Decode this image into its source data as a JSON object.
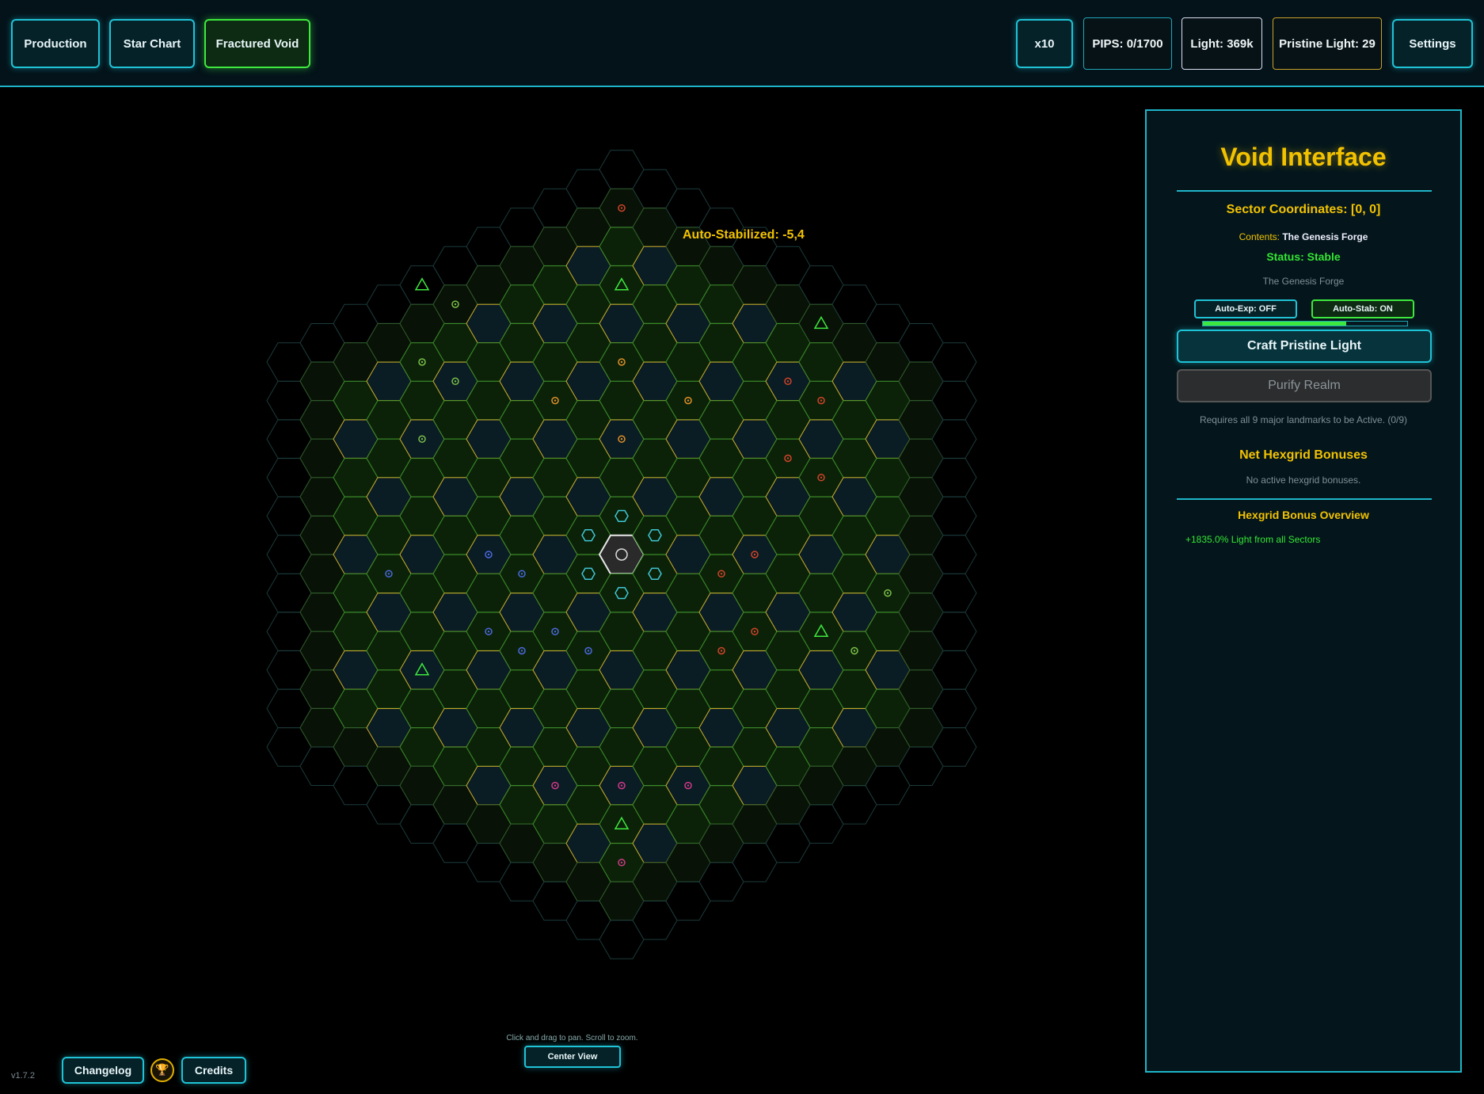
{
  "nav": {
    "production": "Production",
    "star_chart": "Star Chart",
    "fractured_void": "Fractured Void"
  },
  "stats": {
    "multiplier": "x10",
    "pips": "PIPS: 0/1700",
    "light": "Light: 369k",
    "pristine_light": "Pristine Light: 29",
    "settings": "Settings"
  },
  "map": {
    "tooltip": "Auto-Stabilized: -5,4",
    "hint": "Click and drag to pan. Scroll to zoom.",
    "center_view": "Center View"
  },
  "panel": {
    "title": "Void Interface",
    "sector": "Sector Coordinates: [0, 0]",
    "contents_label": "Contents:",
    "contents_value": "The Genesis Forge",
    "status": "Status: Stable",
    "description": "The Genesis Forge",
    "auto_exp": "Auto-Exp: OFF",
    "auto_stab": "Auto-Stab: ON",
    "stab_progress": 0.7,
    "craft": "Craft Pristine Light",
    "purify": "Purify Realm",
    "requires": "Requires all 9 major landmarks to be Active. (0/9)",
    "net_title": "Net Hexgrid Bonuses",
    "net_none": "No active hexgrid bonuses.",
    "overview_title": "Hexgrid Bonus Overview",
    "overview_item": "+1835.0% Light from all Sectors"
  },
  "footer": {
    "version": "v1.7.2",
    "changelog": "Changelog",
    "credits": "Credits"
  },
  "colors": {
    "accent": "#1fc3d6",
    "active": "#3ee83e",
    "gold": "#f2c200",
    "status_green": "#33e633",
    "pristine_border": "#c9a227"
  }
}
